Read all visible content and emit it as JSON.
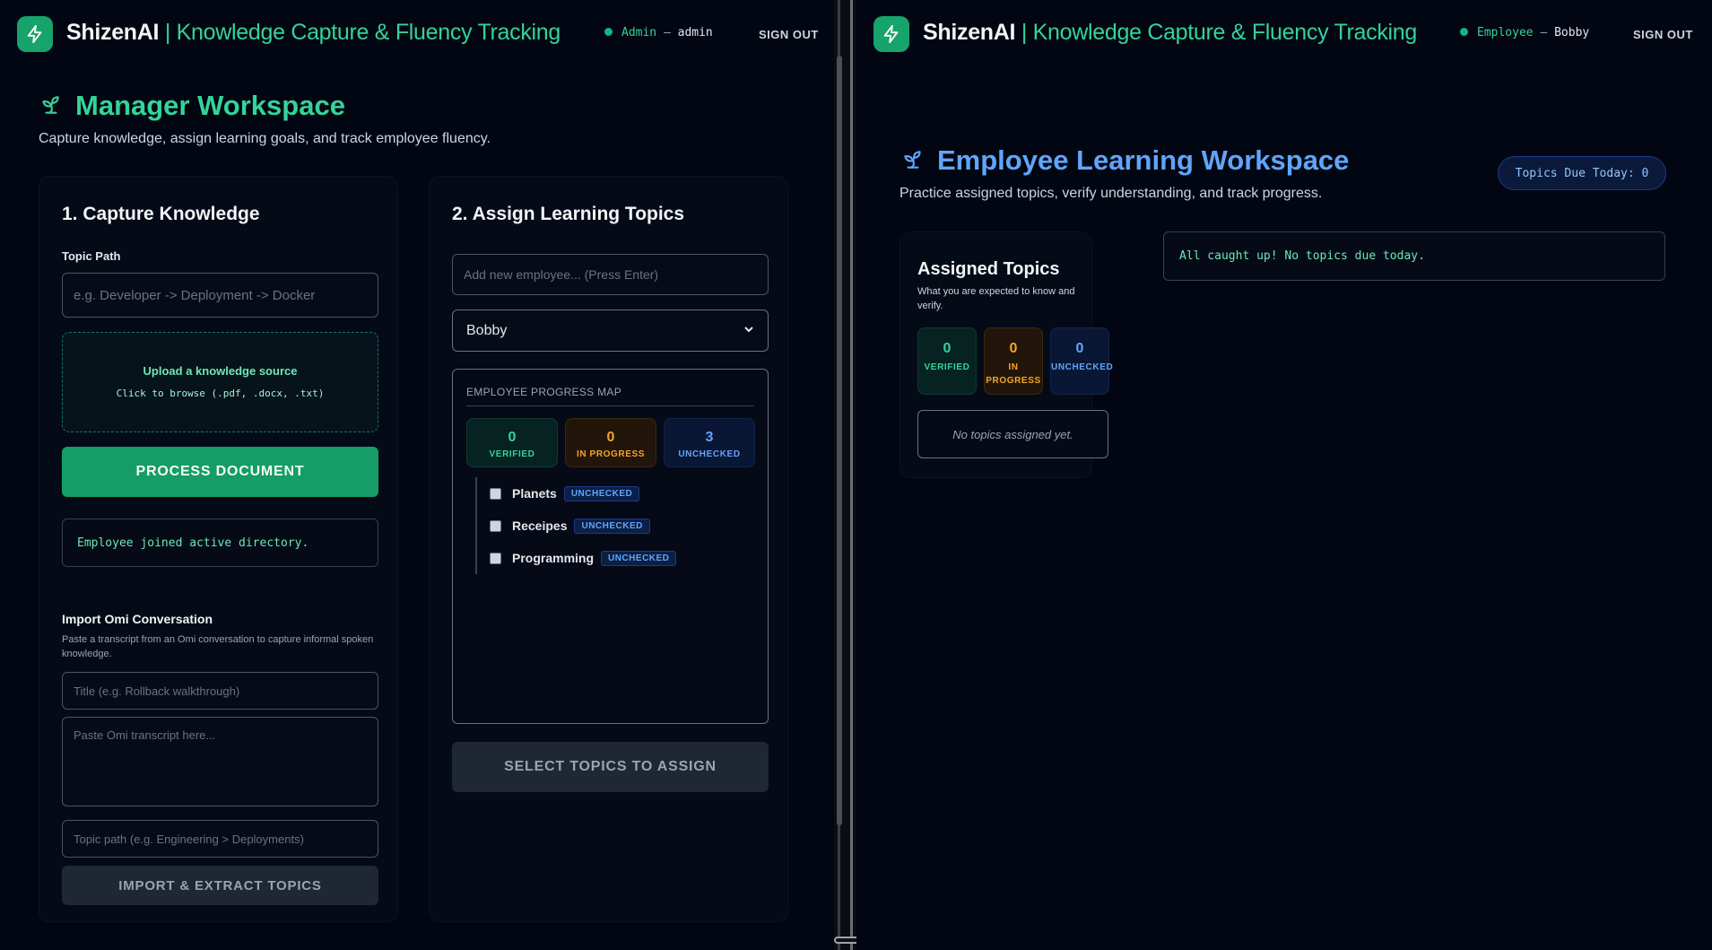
{
  "brand": {
    "name": "ShizenAI",
    "separator": " | ",
    "tagline": "Knowledge Capture & Fluency Tracking"
  },
  "colors": {
    "accent": "#16a36c",
    "manager_title": "#34d399",
    "employee_title": "#60a5fa",
    "background": "#020612"
  },
  "left": {
    "user": {
      "role": "Admin",
      "dash": " — ",
      "name": "admin",
      "signout": "SIGN OUT"
    },
    "title": "Manager Workspace",
    "subtitle": "Capture knowledge, assign learning goals, and track employee fluency.",
    "capture": {
      "heading": "1. Capture Knowledge",
      "topic_path_label": "Topic Path",
      "topic_path_placeholder": "e.g. Developer -> Deployment -> Docker",
      "upload_title": "Upload a knowledge source",
      "upload_hint": "Click to browse (.pdf, .docx, .txt)",
      "process_button": "PROCESS DOCUMENT",
      "status": "Employee joined active directory.",
      "omi_title": "Import Omi Conversation",
      "omi_desc": "Paste a transcript from an Omi conversation to capture informal spoken knowledge.",
      "omi_title_placeholder": "Title (e.g. Rollback walkthrough)",
      "omi_transcript_placeholder": "Paste Omi transcript here...",
      "omi_topic_placeholder": "Topic path (e.g. Engineering > Deployments)",
      "import_button": "IMPORT & EXTRACT TOPICS"
    },
    "assign": {
      "heading": "2. Assign Learning Topics",
      "add_employee_placeholder": "Add new employee... (Press Enter)",
      "selected_employee": "Bobby",
      "map_heading": "EMPLOYEE PROGRESS MAP",
      "stats": {
        "verified": "0",
        "verified_label": "VERIFIED",
        "in_progress": "0",
        "in_progress_label": "IN PROGRESS",
        "unchecked": "3",
        "unchecked_label": "UNCHECKED"
      },
      "topics": [
        {
          "name": "Planets",
          "status": "UNCHECKED"
        },
        {
          "name": "Receipes",
          "status": "UNCHECKED"
        },
        {
          "name": "Programming",
          "status": "UNCHECKED"
        }
      ],
      "assign_button": "SELECT TOPICS TO ASSIGN"
    }
  },
  "right": {
    "user": {
      "role": "Employee",
      "dash": " — ",
      "name": "Bobby",
      "signout": "SIGN OUT"
    },
    "title": "Employee Learning Workspace",
    "subtitle": "Practice assigned topics, verify understanding, and track progress.",
    "due_pill": "Topics Due Today: 0",
    "assigned": {
      "heading": "Assigned Topics",
      "desc": "What you are expected to know and verify.",
      "stats": {
        "verified": "0",
        "verified_label": "VERIFIED",
        "in_progress": "0",
        "in_progress_label_1": "IN",
        "in_progress_label_2": "PROGRESS",
        "unchecked": "0",
        "unchecked_label": "UNCHECKED"
      },
      "empty": "No topics assigned yet."
    },
    "caught_up": "All caught up! No topics due today."
  }
}
